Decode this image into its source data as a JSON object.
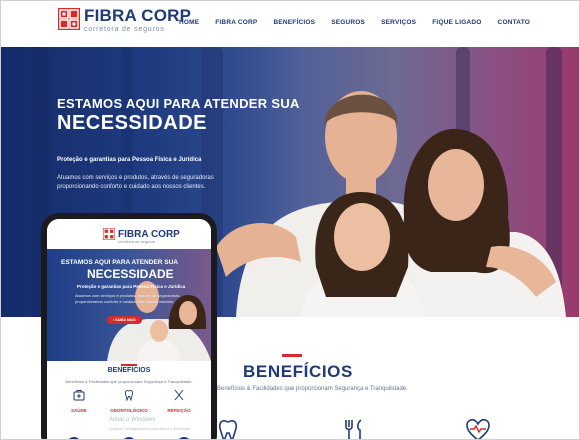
{
  "brand": {
    "name": "FIBRA CORP",
    "tagline": "corretora de seguros",
    "primary_color": "#1e3a78",
    "accent_color": "#d42b2b",
    "logo_icon": "building-grid-icon"
  },
  "nav": {
    "items": [
      "HOME",
      "FIBRA CORP",
      "BENEFÍCIOS",
      "SEGUROS",
      "SERVIÇOS",
      "FIQUE LIGADO",
      "CONTATO"
    ]
  },
  "hero": {
    "title_line1": "ESTAMOS AQUI PARA ATENDER SUA",
    "title_line2": "NECESSIDADE",
    "tagline": "Proteção e garantias para Pessoa Física e Jurídica",
    "description": "Atuamos com serviços e produtos, através de seguradoras proporcionando conforto e cuidado aos nossos clientes."
  },
  "phone": {
    "brand_name": "FIBRA CORP",
    "brand_tagline": "corretora de seguros",
    "hero_title_line1": "ESTAMOS AQUI PARA ATENDER SUA",
    "hero_title_line2": "NECESSIDADE",
    "hero_tagline": "Proteção e garantias para Pessoa Física e Jurídica",
    "hero_description": "Atuamos com serviços e produtos, através de seguradoras proporcionando conforto e cuidado aos nossos clientes.",
    "button_label": "• SAIBA MAIS",
    "benefits_title": "BENEFÍCIOS",
    "benefits_subtitle": "Benefícios & Facilidades que proporcionam Segurança e Tranquilidade.",
    "benefit_items": [
      {
        "label": "SAÚDE",
        "icon": "medical-bag-icon"
      },
      {
        "label": "ODONTOLÓGICO",
        "icon": "tooth-icon"
      },
      {
        "label": "REFEIÇÃO",
        "icon": "cutlery-icon"
      }
    ],
    "watermark_title": "Ativar o Windows",
    "watermark_sub": "Acesse Configurações para ativar o Windows."
  },
  "benefits": {
    "title": "BENEFÍCIOS",
    "subtitle": "Benefícios & Facilidades que proporcionam Segurança e Tranquilidade.",
    "icons": [
      "tooth-icon",
      "cutlery-icon",
      "heart-pulse-icon"
    ]
  }
}
